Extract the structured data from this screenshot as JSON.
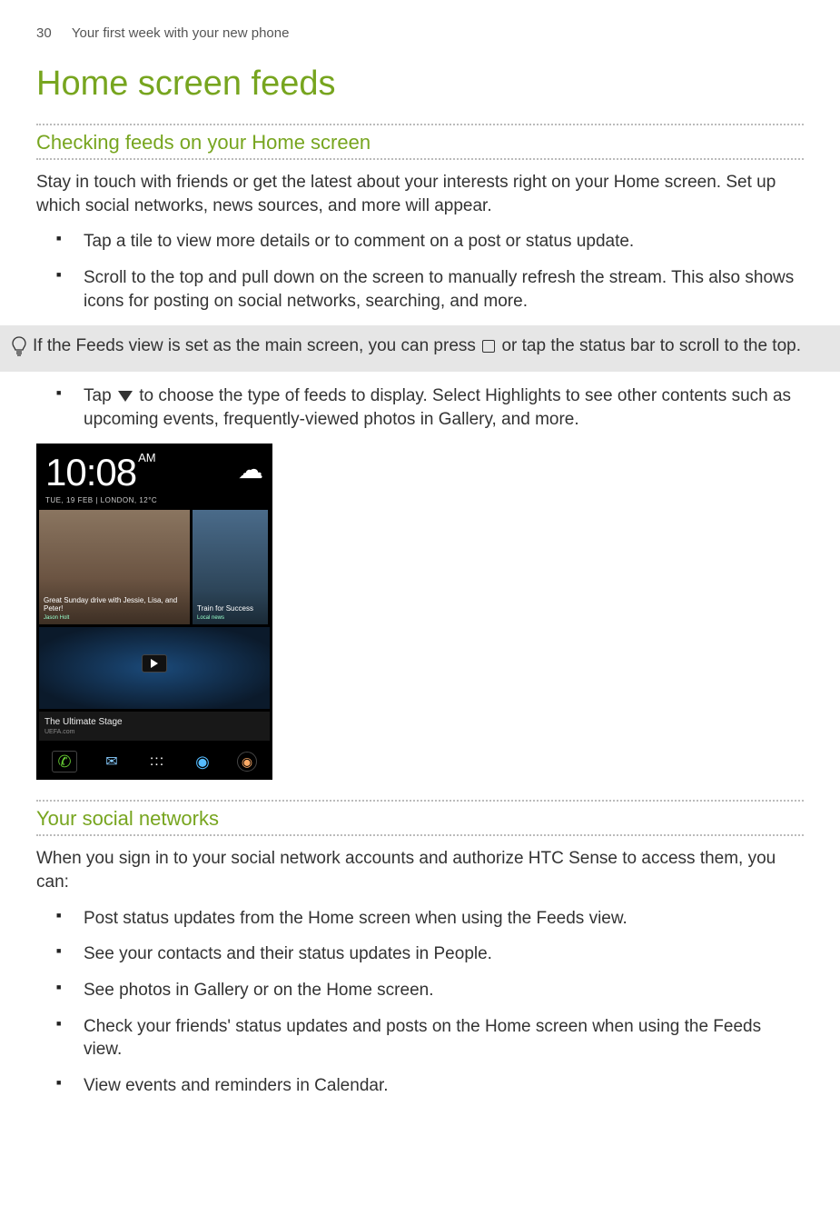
{
  "header": {
    "page_number": "30",
    "chapter": "Your first week with your new phone"
  },
  "title": "Home screen feeds",
  "section1": {
    "heading": "Checking feeds on your Home screen",
    "intro": "Stay in touch with friends or get the latest about your interests right on your Home screen. Set up which social networks, news sources, and more will appear.",
    "bullets_a": [
      "Tap a tile to view more details or to comment on a post or status update.",
      "Scroll to the top and pull down on the screen to manually refresh the stream. This also shows icons for posting on social networks, searching, and more."
    ],
    "tip_pre": "If the Feeds view is set as the main screen, you can press ",
    "tip_post": " or tap the status bar to scroll to the top.",
    "bullet_b_pre": "Tap ",
    "bullet_b_post": " to choose the type of feeds to display. Select Highlights to see other contents such as upcoming events, frequently-viewed photos in Gallery, and more."
  },
  "screenshot": {
    "time": "10:08",
    "ampm": "AM",
    "date_line": "TUE, 19 FEB | LONDON, 12°C",
    "tile1_caption": "Great Sunday drive with Jessie, Lisa, and Peter!",
    "tile1_sub": "Jason Holt",
    "tile2_caption": "Train for Success",
    "tile2_sub": "Local news",
    "tile3_title": "The Ultimate Stage",
    "tile3_sub": "UEFA.com"
  },
  "section2": {
    "heading": "Your social networks",
    "intro": "When you sign in to your social network accounts and authorize HTC Sense to access them, you can:",
    "bullets": [
      "Post status updates from the Home screen when using the Feeds view.",
      "See your contacts and their status updates in People.",
      "See photos in Gallery or on the Home screen.",
      "Check your friends' status updates and posts on the Home screen when using the Feeds view.",
      "View events and reminders in Calendar."
    ]
  }
}
